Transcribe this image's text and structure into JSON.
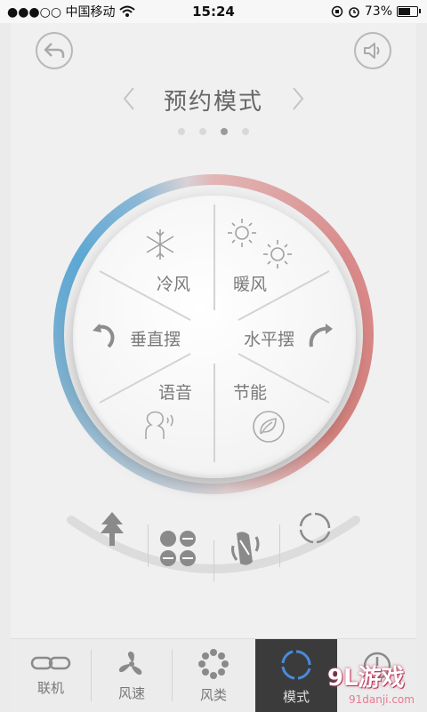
{
  "status_bar": {
    "carrier": "●●●○○ 中国移动",
    "time": "15:24",
    "battery": "73%",
    "battery_level": 0.73
  },
  "header": {
    "back_icon": "back-arrow-icon",
    "sound_icon": "speaker-icon",
    "title": "预约模式",
    "page_dots": {
      "count": 4,
      "active_index": 2
    }
  },
  "dial": {
    "ring_colors": {
      "cool": "#5da8d4",
      "warm": "#d6837f"
    },
    "segments": [
      {
        "label": "冷风",
        "icon": "snowflake-icon"
      },
      {
        "label": "暖风",
        "icon": "sun-icon"
      },
      {
        "label": "垂直摆",
        "icon": "rotate-left-icon"
      },
      {
        "label": "水平摆",
        "icon": "rotate-right-icon"
      },
      {
        "label": "语音",
        "icon": "voice-person-icon"
      },
      {
        "label": "节能",
        "icon": "leaf-icon"
      }
    ]
  },
  "mode_buttons": [
    {
      "icon": "tree-arrow-icon"
    },
    {
      "icon": "four-circles-icon"
    },
    {
      "icon": "swing-icon"
    },
    {
      "icon": "refresh-circle-icon"
    }
  ],
  "tabbar": {
    "tabs": [
      {
        "label": "联机",
        "icon": "link-icon"
      },
      {
        "label": "风速",
        "icon": "fan-icon"
      },
      {
        "label": "风类",
        "icon": "dots-ring-icon"
      },
      {
        "label": "模式",
        "icon": "mode-ring-icon",
        "active": true
      },
      {
        "label": "",
        "icon": "timer-icon"
      }
    ]
  },
  "watermark": {
    "brand": "9L游戏",
    "url": "91danji.com"
  }
}
